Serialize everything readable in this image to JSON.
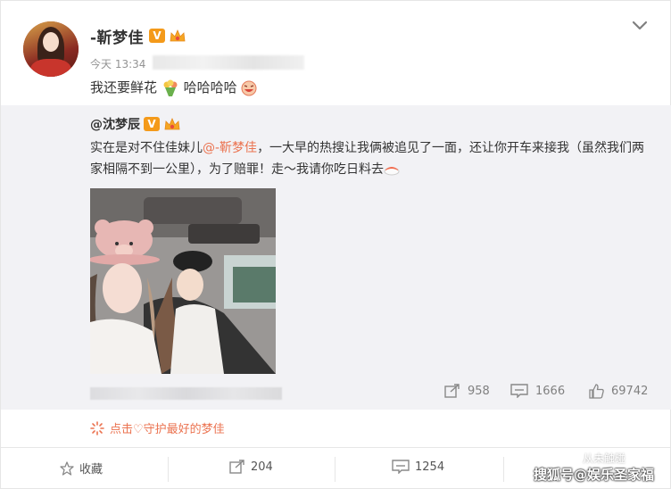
{
  "post": {
    "author": "-靳梦佳",
    "time": "今天 13:34",
    "text": "我还要鲜花",
    "text_suffix": "哈哈哈哈"
  },
  "repost": {
    "author": "@沈梦辰",
    "text_before": "实在是对不住佳妹儿",
    "mention": "@-靳梦佳",
    "text_after": "，一大早的热搜让我俩被追见了一面，还让你开车来接我（虽然我们两家相隔不到一公里），为了赔罪！走～我请你吃日料去",
    "stats": {
      "forward": "958",
      "comment": "1666",
      "like": "69742"
    }
  },
  "promo": {
    "label": "点击♡守护最好的梦佳"
  },
  "actions": {
    "favorite": "收藏",
    "forward": "204",
    "comment": "1254"
  },
  "watermark": {
    "main": "搜狐号@娱乐圣家福",
    "sub": "从未触碰"
  },
  "colors": {
    "mention": "#eb7350",
    "verified_badge": "#f49a1a",
    "repost_bg": "#f2f2f5"
  },
  "icons": [
    "verified-badge-icon",
    "crown-badge-icon",
    "chevron-down-icon",
    "flower-emoji-icon",
    "laugh-emoji-icon",
    "sushi-emoji-icon",
    "forward-icon",
    "comment-icon",
    "like-icon",
    "favorite-star-icon",
    "heart-promo-icon"
  ]
}
